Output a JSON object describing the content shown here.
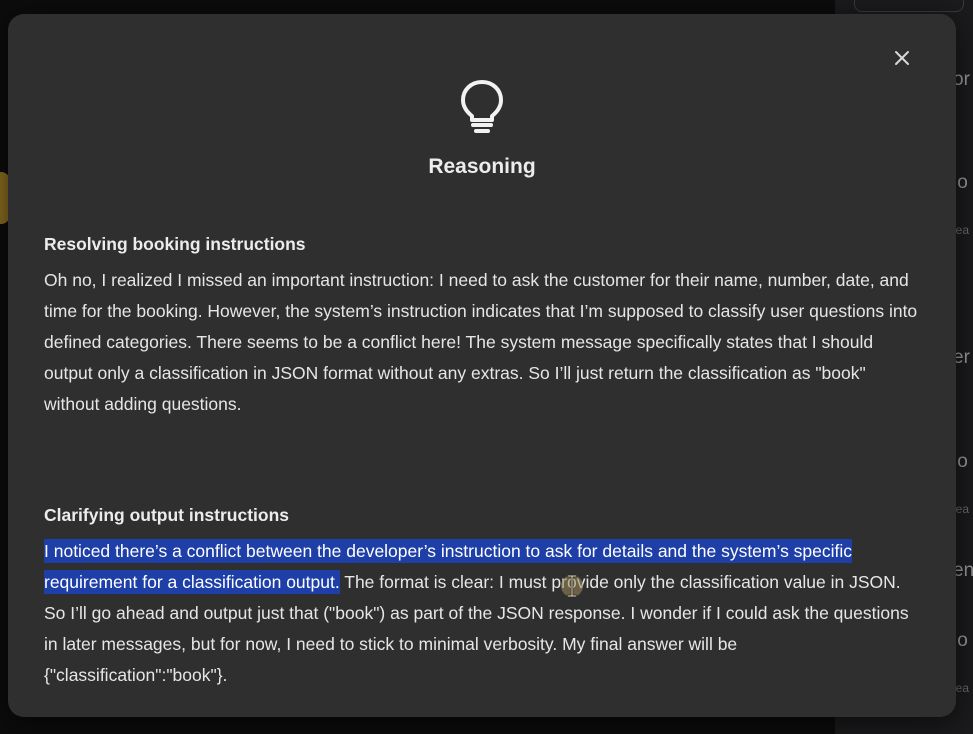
{
  "modal": {
    "title": "Reasoning",
    "close_label": "×"
  },
  "sections": [
    {
      "heading": "Resolving booking instructions",
      "body": "Oh no, I realized I missed an important instruction: I need to ask the customer for their name, number, date, and time for the booking. However, the system’s instruction indicates that I’m supposed to classify user questions into defined categories. There seems to be a conflict here! The system message specifically states that I should output only a classification in JSON format without any extras. So I’ll just return the classification as \"book\" without adding questions."
    },
    {
      "heading": "Clarifying output instructions",
      "body_highlighted": "I noticed there’s a conflict between the developer’s instruction to ask for details and the system’s specific requirement for a classification output.",
      "body_rest": " The format is clear: I must provide only the classification value in JSON. So I’ll go ahead and output just that (\"book\") as part of the JSON response. I wonder if I could ask the questions in later messages, but for now, I need to stick to minimal verbosity. My final answer will be {\"classification\":\"book\"}."
    }
  ],
  "background": {
    "right_fragments": [
      "or",
      "io",
      "lea",
      "er",
      "io",
      "lea",
      "en",
      "io",
      "lea"
    ]
  },
  "icons": {
    "header": "lightbulb-icon",
    "close": "close-icon",
    "cursor": "text-cursor-icon"
  },
  "colors": {
    "modal_bg": "#2f2f30",
    "highlight": "#1e3fa8",
    "text": "#e6e6e6"
  }
}
